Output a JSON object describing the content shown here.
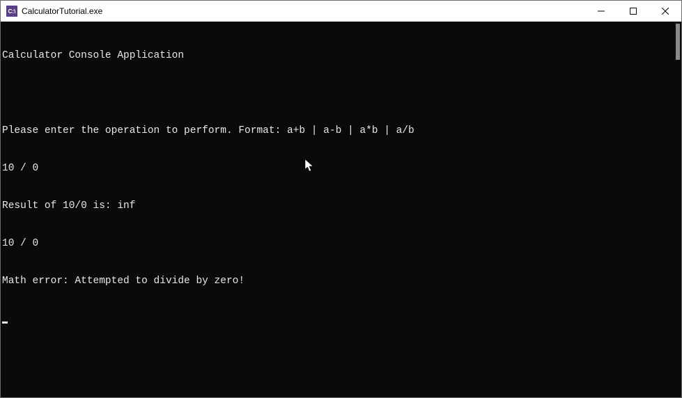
{
  "window": {
    "title": "CalculatorTutorial.exe",
    "icon_text": "C:\\"
  },
  "console": {
    "lines": [
      "Calculator Console Application",
      "",
      "Please enter the operation to perform. Format: a+b | a-b | a*b | a/b",
      "10 / 0",
      "Result of 10/0 is: inf",
      "10 / 0",
      "Math error: Attempted to divide by zero!"
    ]
  }
}
